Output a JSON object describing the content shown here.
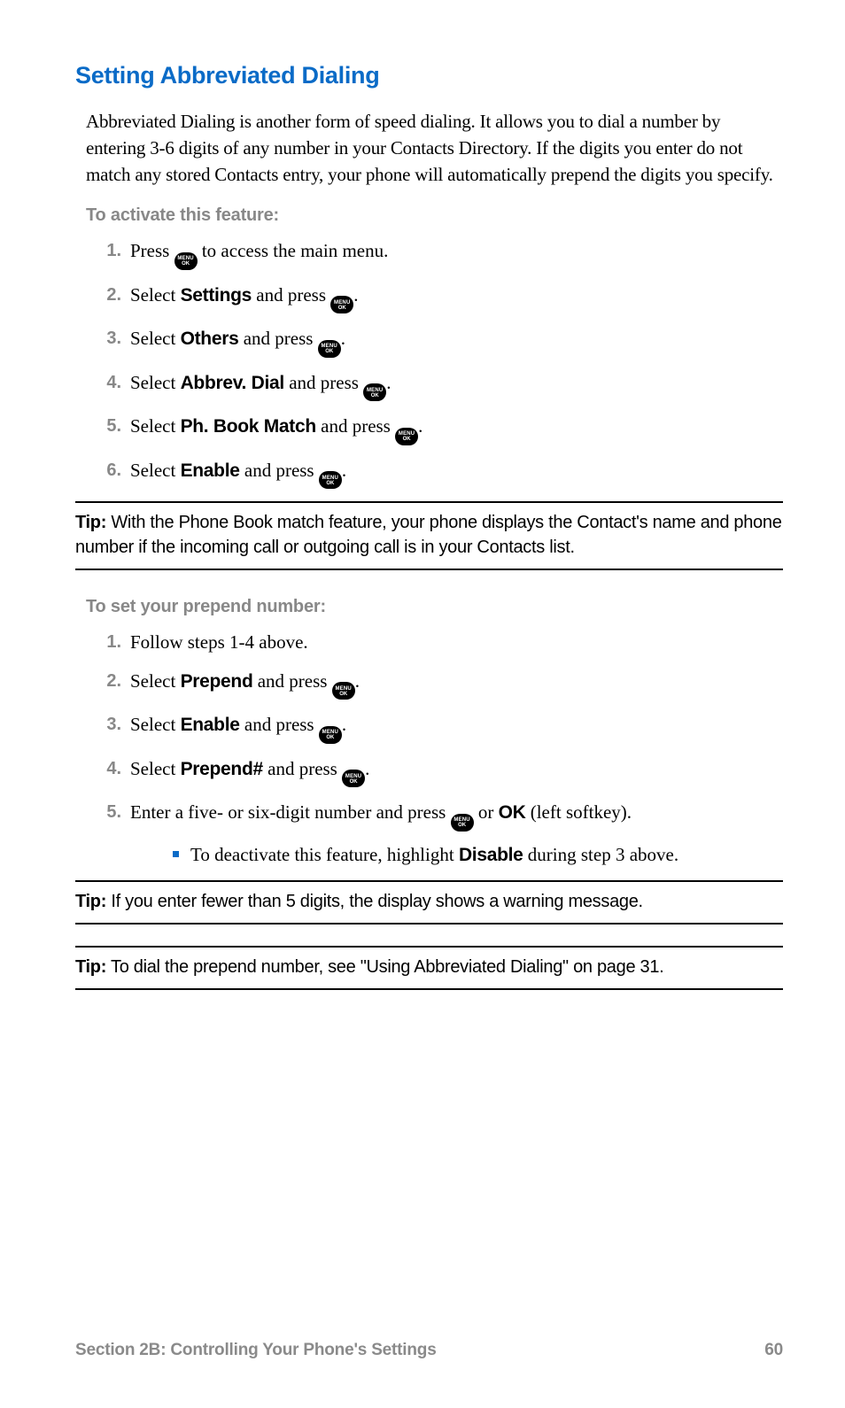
{
  "heading": "Setting Abbreviated Dialing",
  "intro": "Abbreviated Dialing is another form of speed dialing. It allows you to dial a number by entering 3-6 digits of any number in your Contacts Directory. If the digits you enter do not match any stored Contacts entry, your phone will automatically prepend the digits you specify.",
  "activate_label": "To activate this feature:",
  "menu_button": {
    "top": "MENU",
    "bottom": "OK"
  },
  "steps_activate": {
    "s1_a": "Press ",
    "s1_b": " to access the main menu.",
    "s2_a": "Select ",
    "s2_bold": "Settings",
    "s2_b": " and press ",
    "s3_a": "Select ",
    "s3_bold": "Others",
    "s3_b": " and press ",
    "s4_a": "Select ",
    "s4_bold": "Abbrev. Dial",
    "s4_b": " and press ",
    "s5_a": "Select ",
    "s5_bold": "Ph. Book Match",
    "s5_b": " and press ",
    "s6_a": "Select ",
    "s6_bold": "Enable",
    "s6_b": " and press "
  },
  "tip1_label": "Tip:",
  "tip1_text": " With the Phone Book match feature, your phone displays the Contact's name and phone number if the incoming call or outgoing call is in your Contacts list.",
  "prepend_label": "To set your prepend number:",
  "steps_prepend": {
    "p1": "Follow steps 1-4 above.",
    "p2_a": "Select ",
    "p2_bold": "Prepend",
    "p2_b": " and press ",
    "p3_a": "Select ",
    "p3_bold": "Enable",
    "p3_b": " and press ",
    "p4_a": "Select ",
    "p4_bold": "Prepend#",
    "p4_b": " and press ",
    "p5_a": "Enter a five- or six-digit number and press ",
    "p5_b": " or ",
    "p5_bold": "OK",
    "p5_c": " (left softkey).",
    "sub_a": "To deactivate this feature, highlight ",
    "sub_bold": "Disable",
    "sub_b": " during step 3 above."
  },
  "tip2_label": "Tip:",
  "tip2_text": " If you enter fewer than 5 digits, the display shows a warning message.",
  "tip3_label": "Tip:",
  "tip3_text": " To dial the prepend number, see \"Using Abbreviated Dialing\" on page 31.",
  "footer_left": "Section 2B: Controlling Your Phone's Settings",
  "footer_right": "60"
}
